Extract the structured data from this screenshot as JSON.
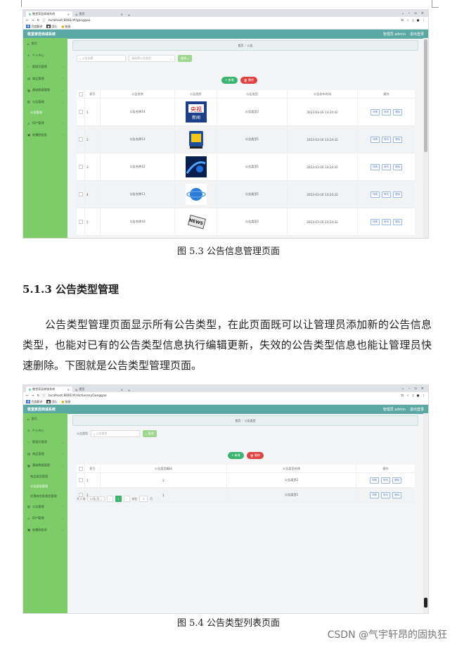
{
  "browser": {
    "tab_active": "敬堂家居商城系统",
    "tab_other": "首页",
    "url1": "localhost:8081/#/gonggao",
    "url2": "localhost:8081/#/dictionaryGonggao",
    "bookmarks": [
      "百度翻译",
      "团队",
      "链接"
    ]
  },
  "app": {
    "title": "敬堂家居商城系统",
    "user": "管理员 admin",
    "logout": "退出登录"
  },
  "sidebar1": [
    {
      "label": "首页",
      "icon": "home-icon"
    },
    {
      "label": "个人中心",
      "icon": "user-icon"
    },
    {
      "label": "管理员管理",
      "icon": "admin-icon"
    },
    {
      "label": "商品管理",
      "icon": "goods-icon"
    },
    {
      "label": "基础数据管理",
      "icon": "data-icon"
    },
    {
      "label": "公告管理",
      "icon": "notice-icon"
    }
  ],
  "sidebar1_sub": "公告管理",
  "sidebar1_after": [
    {
      "label": "用户管理",
      "icon": "users-icon"
    },
    {
      "label": "轮播图信息",
      "icon": "carousel-icon"
    }
  ],
  "sidebar2": [
    {
      "label": "首页",
      "icon": "home-icon"
    },
    {
      "label": "个人中心",
      "icon": "user-icon"
    },
    {
      "label": "管理员管理",
      "icon": "admin-icon"
    },
    {
      "label": "商品管理",
      "icon": "goods-icon"
    },
    {
      "label": "基础数据管理",
      "icon": "data-icon"
    }
  ],
  "sidebar2_subs": [
    "商品类型管理",
    "公告类型管理",
    "优惠卷信息类型管理"
  ],
  "sidebar2_after": [
    {
      "label": "公告管理",
      "icon": "notice-icon"
    },
    {
      "label": "用户管理",
      "icon": "users-icon"
    },
    {
      "label": "轮播图信息",
      "icon": "carousel-icon"
    }
  ],
  "page1": {
    "breadcrumb_home": "首页",
    "breadcrumb_current": "公告",
    "search_name_placeholder": "公告标题",
    "search_type_placeholder": "请选择公告类型",
    "search_button": "查询",
    "add_button": "+ 新增",
    "delete_button": "删除",
    "columns": [
      "索引",
      "公告名称",
      "公告图片",
      "公告类型",
      "公告发布时间",
      "操作"
    ],
    "rows": [
      {
        "idx": "1",
        "name": "公告名称14",
        "type": "公告类型2",
        "time": "2023-03-16 13:24:32"
      },
      {
        "idx": "2",
        "name": "公告名称13",
        "type": "公告类型1",
        "time": "2023-03-16 13:24:32"
      },
      {
        "idx": "3",
        "name": "公告名称12",
        "type": "公告类型1",
        "time": "2023-03-16 13:24:32"
      },
      {
        "idx": "4",
        "name": "公告名称11",
        "type": "公告类型1",
        "time": "2023-03-16 13:24:32"
      },
      {
        "idx": "5",
        "name": "公告名称10",
        "type": "公告类型2",
        "time": "2023-03-16 13:24:32"
      }
    ],
    "op_detail": "详情",
    "op_edit": "修改",
    "op_delete": "删除"
  },
  "page2": {
    "breadcrumb_home": "首页",
    "breadcrumb_current": "公告类型",
    "search_label": "公告类型",
    "search_placeholder": "公告类型",
    "search_button": "查询",
    "add_button": "+ 新增",
    "delete_button": "删除",
    "columns": [
      "索引",
      "公告类型编码",
      "公告类型名称",
      "操作"
    ],
    "rows": [
      {
        "idx": "1",
        "code": "2",
        "name": "公告类型2"
      },
      {
        "idx": "2",
        "code": "1",
        "name": "公告类型1"
      }
    ],
    "pager_total": "共 2 条",
    "pager_size": "10条/页",
    "pager_page": "1",
    "pager_goto": "前往",
    "pager_goto_value": "1",
    "pager_unit": "页"
  },
  "doc": {
    "caption1": "图 5.3  公告信息管理页面",
    "heading": "5.1.3 公告类型管理",
    "paragraph": "公告类型管理页面显示所有公告类型，在此页面既可以让管理员添加新的公告信息类型，也能对已有的公告类型信息执行编辑更新，失效的公告类型信息也能让管理员快速删除。下图就是公告类型管理页面。",
    "caption2": "图 5.4  公告类型列表页面",
    "watermark": "CSDN @气宇轩昂的固执狂"
  },
  "colors": {
    "topbar": "#5aa9a4",
    "sidebar": "#7ccd68",
    "add": "#3cb371",
    "delete": "#e04141"
  }
}
